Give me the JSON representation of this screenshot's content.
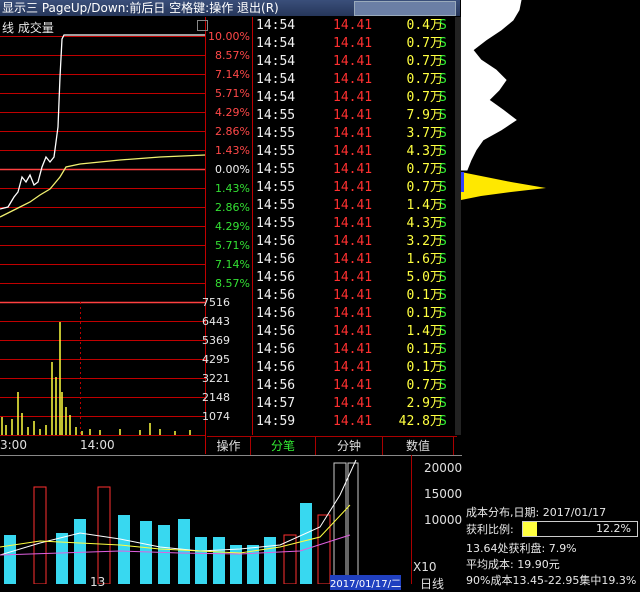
{
  "window": {
    "title": "显示三 PageUp/Down:前后日 空格键:操作 退出(R)"
  },
  "chart": {
    "label": "线 成交量",
    "pct_labels_up": [
      "10.00%",
      "8.57%",
      "7.14%",
      "5.71%",
      "4.29%",
      "2.86%",
      "1.43%"
    ],
    "pct_zero": "0.00%",
    "pct_labels_down": [
      "1.43%",
      "2.86%",
      "4.29%",
      "5.71%",
      "7.14%",
      "8.57%"
    ],
    "vol_labels": [
      "7516",
      "6443",
      "5369",
      "4295",
      "3221",
      "2148",
      "1074"
    ],
    "time_labels": [
      "3:00",
      "14:00"
    ]
  },
  "trades": [
    {
      "time": "14:54",
      "price": "14.41",
      "vol": "0.4",
      "unit": "万",
      "bs": "S"
    },
    {
      "time": "14:54",
      "price": "14.41",
      "vol": "0.7",
      "unit": "万",
      "bs": "S"
    },
    {
      "time": "14:54",
      "price": "14.41",
      "vol": "0.7",
      "unit": "万",
      "bs": "S"
    },
    {
      "time": "14:54",
      "price": "14.41",
      "vol": "0.7",
      "unit": "万",
      "bs": "S"
    },
    {
      "time": "14:54",
      "price": "14.41",
      "vol": "0.7",
      "unit": "万",
      "bs": "S"
    },
    {
      "time": "14:55",
      "price": "14.41",
      "vol": "7.9",
      "unit": "万",
      "bs": "S"
    },
    {
      "time": "14:55",
      "price": "14.41",
      "vol": "3.7",
      "unit": "万",
      "bs": "S"
    },
    {
      "time": "14:55",
      "price": "14.41",
      "vol": "4.3",
      "unit": "万",
      "bs": "S"
    },
    {
      "time": "14:55",
      "price": "14.41",
      "vol": "0.7",
      "unit": "万",
      "bs": "S"
    },
    {
      "time": "14:55",
      "price": "14.41",
      "vol": "0.7",
      "unit": "万",
      "bs": "S"
    },
    {
      "time": "14:55",
      "price": "14.41",
      "vol": "1.4",
      "unit": "万",
      "bs": "S"
    },
    {
      "time": "14:55",
      "price": "14.41",
      "vol": "4.3",
      "unit": "万",
      "bs": "S"
    },
    {
      "time": "14:56",
      "price": "14.41",
      "vol": "3.2",
      "unit": "万",
      "bs": "S"
    },
    {
      "time": "14:56",
      "price": "14.41",
      "vol": "1.6",
      "unit": "万",
      "bs": "S"
    },
    {
      "time": "14:56",
      "price": "14.41",
      "vol": "5.0",
      "unit": "万",
      "bs": "S"
    },
    {
      "time": "14:56",
      "price": "14.41",
      "vol": "0.1",
      "unit": "万",
      "bs": "S"
    },
    {
      "time": "14:56",
      "price": "14.41",
      "vol": "0.1",
      "unit": "万",
      "bs": "S"
    },
    {
      "time": "14:56",
      "price": "14.41",
      "vol": "1.4",
      "unit": "万",
      "bs": "S"
    },
    {
      "time": "14:56",
      "price": "14.41",
      "vol": "0.1",
      "unit": "万",
      "bs": "S"
    },
    {
      "time": "14:56",
      "price": "14.41",
      "vol": "0.1",
      "unit": "万",
      "bs": "S"
    },
    {
      "time": "14:56",
      "price": "14.41",
      "vol": "0.7",
      "unit": "万",
      "bs": "S"
    },
    {
      "time": "14:57",
      "price": "14.41",
      "vol": "2.9",
      "unit": "万",
      "bs": "S"
    },
    {
      "time": "14:59",
      "price": "14.41",
      "vol": "42.8",
      "unit": "万",
      "bs": "S"
    }
  ],
  "tabs": [
    {
      "label": "操作",
      "active": false
    },
    {
      "label": "分笔",
      "active": true
    },
    {
      "label": "分钟",
      "active": false
    },
    {
      "label": "数值",
      "active": false
    }
  ],
  "bottom": {
    "y_labels": [
      "20000",
      "15000",
      "10000"
    ],
    "x10": "X10",
    "date_label": "2017/01/17/二",
    "day_label": "日线",
    "x_tick": "13"
  },
  "info": {
    "title": "成本分布,日期: 2017/01/17",
    "profit_label": "获利比例:",
    "profit_value": "12.2%",
    "profit_fraction": 0.122,
    "line3": "13.64处获利盘: 7.9%",
    "line4": "平均成本: 19.90元",
    "line5": "90%成本13.45-22.95集中19.3%"
  },
  "colors": {
    "up": "#ff3030",
    "down": "#33ee33",
    "vol": "#ffff40",
    "grid": "#c00000",
    "cyan": "#38d8f0"
  }
}
